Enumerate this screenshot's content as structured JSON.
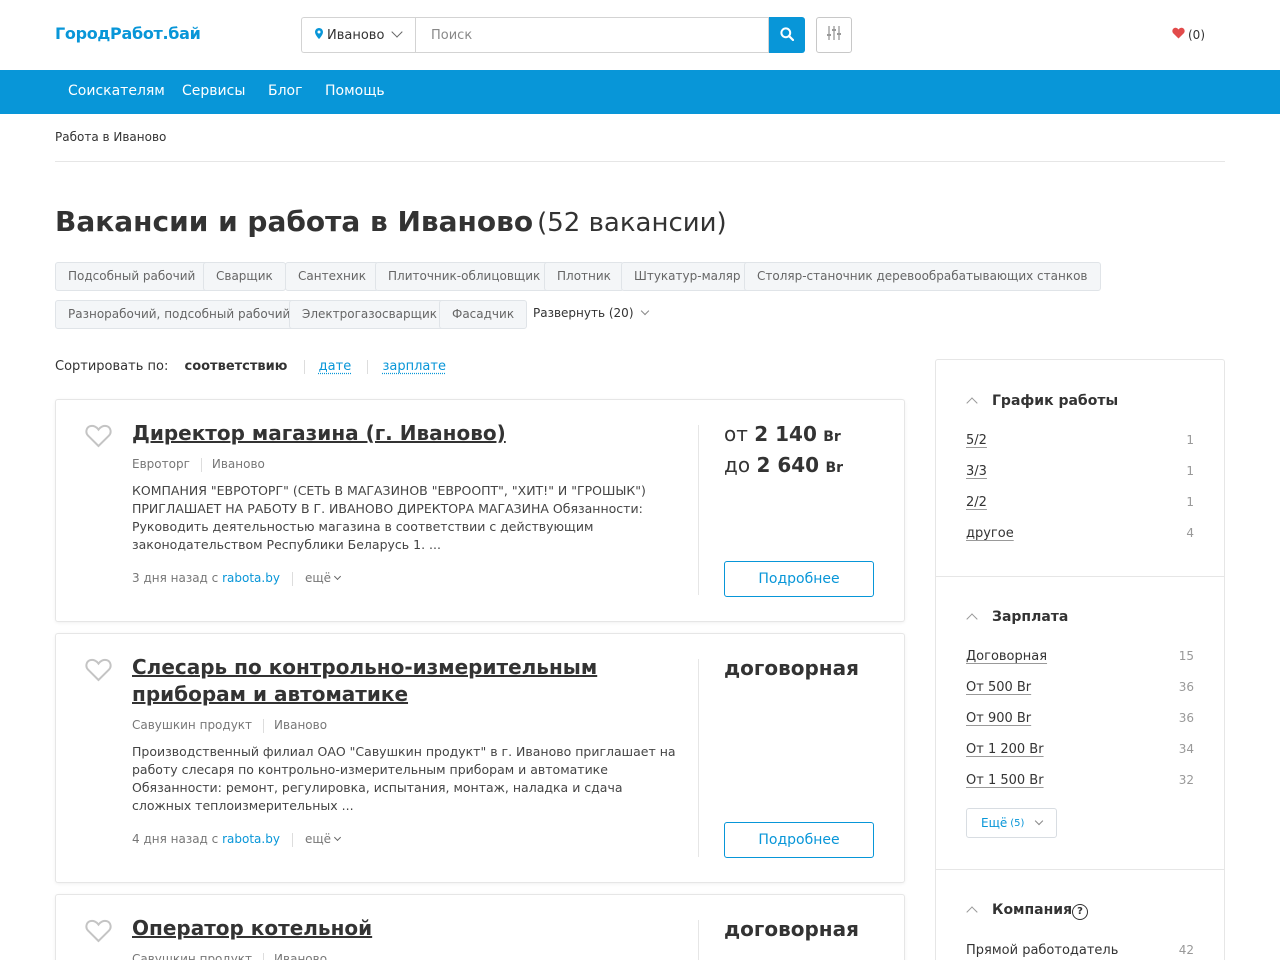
{
  "header": {
    "logo": "ГородРабот.бай",
    "city": "Иваново",
    "search_placeholder": "Поиск",
    "favorites_count": "(0)"
  },
  "nav": {
    "items": [
      "Соискателям",
      "Сервисы",
      "Блог",
      "Помощь"
    ]
  },
  "breadcrumb": "Работа в Иваново",
  "title": {
    "main": "Вакансии и работа в Иваново",
    "count": "(52 вакансии)"
  },
  "tags": [
    "Подсобный рабочий",
    "Сварщик",
    "Сантехник",
    "Плиточник-облицовщик",
    "Плотник",
    "Штукатур-маляр",
    "Столяр-станочник деревообрабатывающих станков",
    "Разнорабочий, подсобный рабочий",
    "Электрогазосварщик",
    "Фасадчик"
  ],
  "tags_expand": "Развернуть (20)",
  "sort": {
    "label": "Сортировать по:",
    "active": "соответствию",
    "options": [
      "дате",
      "зарплате"
    ]
  },
  "vacancies": [
    {
      "title": "Директор магазина (г. Иваново)",
      "company": "Евроторг",
      "city": "Иваново",
      "description": "КОМПАНИЯ \"ЕВРОТОРГ\" (СЕТЬ В МАГАЗИНОВ \"ЕВРООПТ\", \"ХИТ!\" И \"ГРОШЫК\") ПРИГЛАШАЕТ НА РАБОТУ В Г. ИВАНОВО ДИРЕКТОРА МАГАЗИНА Обязанности: Руководить деятельностью магазина в соответствии с действующим законодательством Республики Беларусь 1. ...",
      "posted": "3 дня назад с",
      "source": "rabota.by",
      "more": "ещё",
      "salary_from_prefix": "от",
      "salary_from": "2 140",
      "salary_to_prefix": "до",
      "salary_to": "2 640",
      "currency": "Br",
      "button": "Подробнее"
    },
    {
      "title": "Слесарь по контрольно-измерительным приборам и автоматике",
      "company": "Савушкин продукт",
      "city": "Иваново",
      "description": "Производственный филиал ОАО \"Савушкин продукт\" в г. Иваново приглашает на работу слесаря по контрольно-измерительным приборам и автоматике Обязанности: ремонт, регулировка, испытания, монтаж, наладка и сдача сложных теплоизмерительных ...",
      "posted": "4 дня назад с",
      "source": "rabota.by",
      "more": "ещё",
      "salary": "договорная",
      "button": "Подробнее"
    },
    {
      "title": "Оператор котельной",
      "company": "Савушкин продукт",
      "city": "Иваново",
      "salary": "договорная"
    }
  ],
  "filters": {
    "schedule": {
      "title": "График работы",
      "items": [
        {
          "label": "5/2",
          "count": "1"
        },
        {
          "label": "3/3",
          "count": "1"
        },
        {
          "label": "2/2",
          "count": "1"
        },
        {
          "label": "другое",
          "count": "4"
        }
      ]
    },
    "salary": {
      "title": "Зарплата",
      "items": [
        {
          "label": "Договорная",
          "count": "15"
        },
        {
          "label": "От 500 Br",
          "count": "36"
        },
        {
          "label": "От 900 Br",
          "count": "36"
        },
        {
          "label": "От 1 200 Br",
          "count": "34"
        },
        {
          "label": "От 1 500 Br",
          "count": "32"
        }
      ],
      "more_label": "Ещё",
      "more_count": "(5)"
    },
    "company": {
      "title": "Компания",
      "items": [
        {
          "label": "Прямой работодатель",
          "count": "42"
        }
      ]
    }
  },
  "colors": {
    "brand": "#0896d8",
    "heart": "#e24b4b"
  }
}
